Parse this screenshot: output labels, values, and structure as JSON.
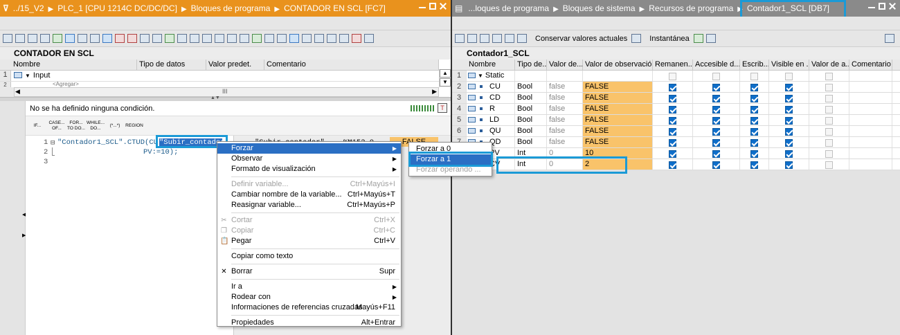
{
  "left": {
    "breadcrumb": [
      "../15_V2",
      "PLC_1 [CPU 1214C DC/DC/DC]",
      "Bloques de programa",
      "CONTADOR EN SCL [FC7]"
    ],
    "block_title": "CONTADOR EN SCL",
    "iface_headers": [
      "Nombre",
      "Tipo de datos",
      "Valor predet.",
      "Comentario"
    ],
    "iface_rows": [
      {
        "num": "1",
        "name": "Input"
      },
      {
        "num": "2",
        "name": "<Agregar>"
      }
    ],
    "scroll_mid": "III",
    "condition": "No se ha definido ninguna condición.",
    "instructions": [
      "IF...",
      "CASE... OF...",
      "FOR... TO DO...",
      "WHILE... DO...",
      "(*...*)",
      "REGION"
    ],
    "code_lines": [
      {
        "num": "1",
        "text": "\"Contador1_SCL\".CTUD(CU:",
        "highlight": "\"Subir_contador\""
      },
      {
        "num": "2",
        "text": "PV:=10);"
      },
      {
        "num": "3",
        "text": ""
      }
    ],
    "monitor": {
      "var": "\"Subir_contador\"",
      "addr": "%M152.0",
      "value": "FALSE"
    }
  },
  "right": {
    "breadcrumb": [
      "...loques de programa",
      "Bloques de sistema",
      "Recursos de programa",
      "Contador1_SCL [DB7]"
    ],
    "toolbar_labels": [
      "Conservar valores actuales",
      "Instantánea"
    ],
    "db_title": "Contador1_SCL",
    "headers": [
      "Nombre",
      "Tipo de...",
      "Valor de...",
      "Valor de observación",
      "Remanen...",
      "Accesible d...",
      "Escrib...",
      "Visible en ...",
      "Valor de a...",
      "Comentario"
    ],
    "rows": [
      {
        "num": "1",
        "name": "Static",
        "type": "",
        "start": "",
        "obs": "",
        "static": true
      },
      {
        "num": "2",
        "name": "CU",
        "type": "Bool",
        "start": "false",
        "obs": "FALSE"
      },
      {
        "num": "3",
        "name": "CD",
        "type": "Bool",
        "start": "false",
        "obs": "FALSE"
      },
      {
        "num": "4",
        "name": "R",
        "type": "Bool",
        "start": "false",
        "obs": "FALSE"
      },
      {
        "num": "5",
        "name": "LD",
        "type": "Bool",
        "start": "false",
        "obs": "FALSE"
      },
      {
        "num": "6",
        "name": "QU",
        "type": "Bool",
        "start": "false",
        "obs": "FALSE"
      },
      {
        "num": "7",
        "name": "QD",
        "type": "Bool",
        "start": "false",
        "obs": "FALSE"
      },
      {
        "num": "8",
        "name": "PV",
        "type": "Int",
        "start": "0",
        "obs": "10"
      },
      {
        "num": "9",
        "name": "CV",
        "type": "Int",
        "start": "0",
        "obs": "2"
      }
    ]
  },
  "context_menu": {
    "items": [
      {
        "label": "Forzar",
        "shortcut": "",
        "submenu": true,
        "state": "hl"
      },
      {
        "label": "Observar",
        "shortcut": "",
        "submenu": true
      },
      {
        "label": "Formato de visualización",
        "shortcut": "",
        "submenu": true
      },
      {
        "sep": true
      },
      {
        "label": "Definir variable...",
        "shortcut": "Ctrl+Mayús+I",
        "state": "dis"
      },
      {
        "label": "Cambiar nombre de la variable...",
        "shortcut": "Ctrl+Mayús+T"
      },
      {
        "label": "Reasignar variable...",
        "shortcut": "Ctrl+Mayús+P"
      },
      {
        "sep": true
      },
      {
        "label": "Cortar",
        "shortcut": "Ctrl+X",
        "state": "dis",
        "icon": "scissors-icon",
        "glyph": "✂"
      },
      {
        "label": "Copiar",
        "shortcut": "Ctrl+C",
        "state": "dis",
        "icon": "copy-icon",
        "glyph": "❐"
      },
      {
        "label": "Pegar",
        "shortcut": "Ctrl+V",
        "icon": "paste-icon",
        "glyph": "📋"
      },
      {
        "sep": true
      },
      {
        "label": "Copiar como texto",
        "shortcut": ""
      },
      {
        "sep": true
      },
      {
        "label": "Borrar",
        "shortcut": "Supr",
        "icon": "delete-icon",
        "glyph": "✕"
      },
      {
        "sep": true
      },
      {
        "label": "Ir a",
        "shortcut": "",
        "submenu": true
      },
      {
        "label": "Rodear con",
        "shortcut": "",
        "submenu": true
      },
      {
        "label": "Informaciones de referencias cruzadas",
        "shortcut": "Mayús+F11"
      },
      {
        "sep": true
      },
      {
        "label": "Propiedades",
        "shortcut": "Alt+Entrar"
      }
    ],
    "submenu": [
      {
        "label": "Forzar a 0"
      },
      {
        "label": "Forzar a 1",
        "state": "hl"
      },
      {
        "label": "Forzar operando ...",
        "state": "dis"
      }
    ]
  },
  "colors": {
    "accent_orange": "#e9921d",
    "highlight_box": "#1b9ad6",
    "menu_highlight": "#2b6fc4",
    "observation_cell": "#f9c36a"
  }
}
